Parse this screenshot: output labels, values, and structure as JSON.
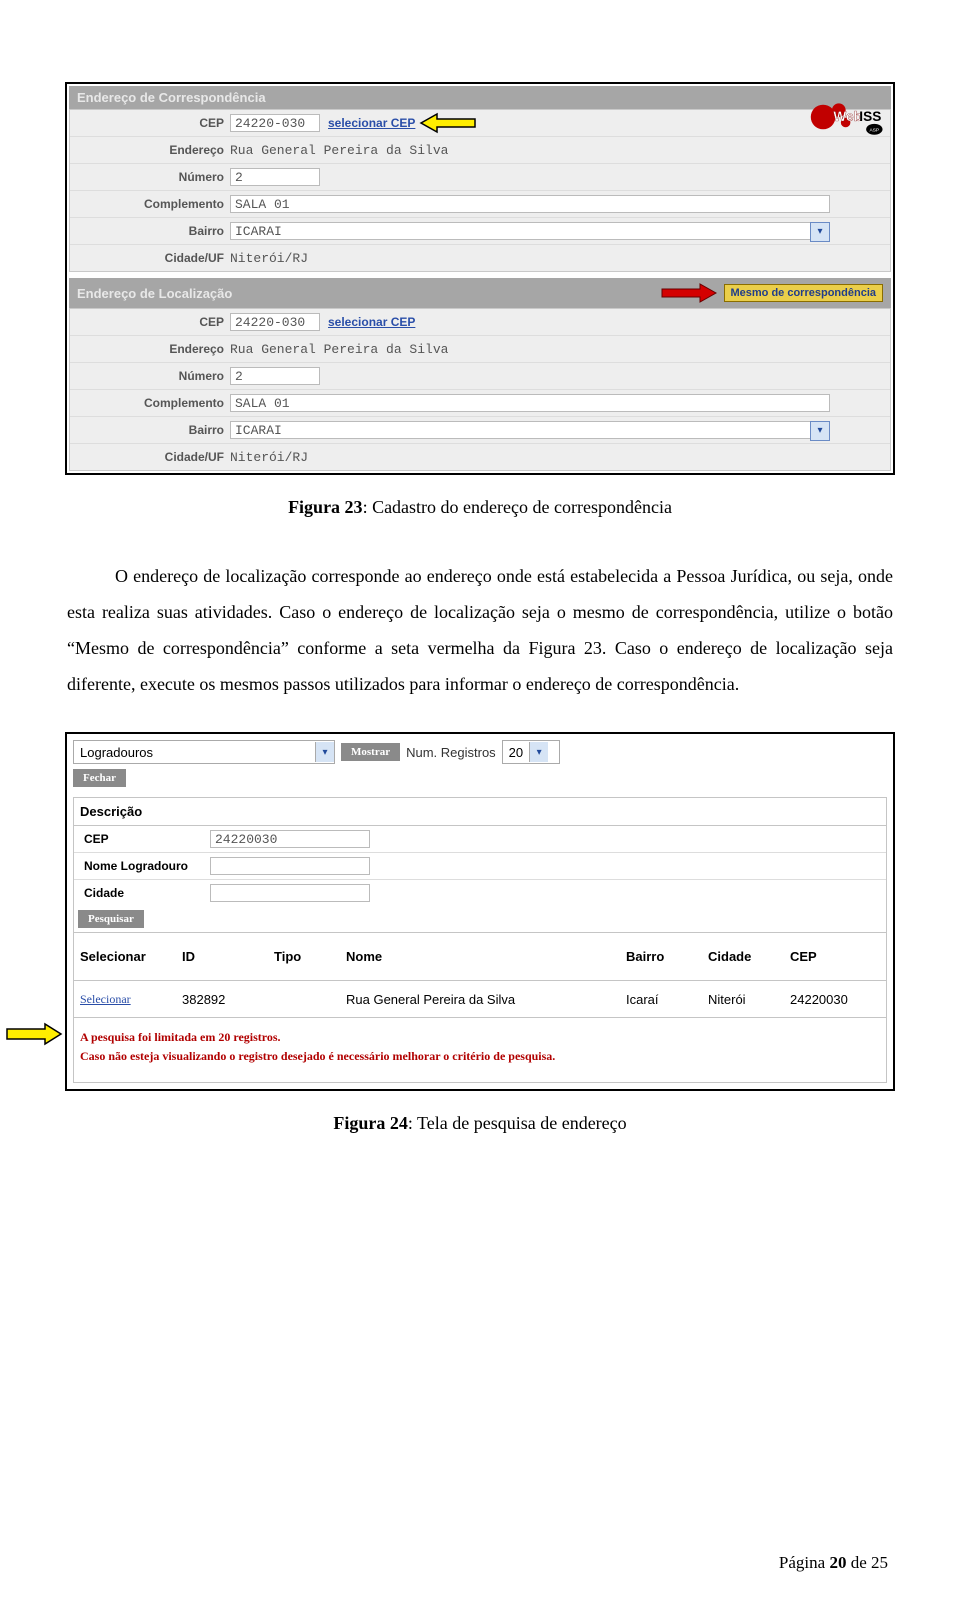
{
  "logo_text": "WebISS",
  "section1": {
    "title": "Endereço de Correspondência",
    "cep_label": "CEP",
    "cep_value": "24220-030",
    "cep_link": "selecionar CEP",
    "endereco_label": "Endereço",
    "endereco_value": "Rua General Pereira da Silva",
    "numero_label": "Número",
    "numero_value": "2",
    "complemento_label": "Complemento",
    "complemento_value": "SALA 01",
    "bairro_label": "Bairro",
    "bairro_value": "ICARAI",
    "cidade_label": "Cidade/UF",
    "cidade_value": "Niterói/RJ"
  },
  "section2": {
    "title": "Endereço de Localização",
    "mesmo_btn": "Mesmo de correspondência",
    "cep_label": "CEP",
    "cep_value": "24220-030",
    "cep_link": "selecionar CEP",
    "endereco_label": "Endereço",
    "endereco_value": "Rua General Pereira da Silva",
    "numero_label": "Número",
    "numero_value": "2",
    "complemento_label": "Complemento",
    "complemento_value": "SALA 01",
    "bairro_label": "Bairro",
    "bairro_value": "ICARAI",
    "cidade_label": "Cidade/UF",
    "cidade_value": "Niterói/RJ"
  },
  "caption1_b": "Figura 23",
  "caption1_r": ": Cadastro do endereço de correspondência",
  "paragraph": "O endereço de localização corresponde ao endereço onde está estabelecida a Pessoa Jurídica, ou seja, onde esta realiza suas atividades. Caso o endereço de localização seja o mesmo de correspondência, utilize o botão “Mesmo de correspondência” conforme a seta vermelha da Figura 23. Caso o endereço de localização seja diferente, execute os mesmos passos utilizados para informar o endereço de correspondência.",
  "figure2": {
    "combo_value": "Logradouros",
    "btn_mostrar": "Mostrar",
    "reg_label": "Num. Registros",
    "reg_value": "20",
    "btn_fechar": "Fechar",
    "desc_heading": "Descrição",
    "cep_label": "CEP",
    "cep_value": "24220030",
    "nome_label": "Nome Logradouro",
    "nome_value": "",
    "cidade_label": "Cidade",
    "cidade_value": "",
    "btn_pesquisar": "Pesquisar",
    "columns": {
      "sel": "Selecionar",
      "id": "ID",
      "tipo": "Tipo",
      "nome": "Nome",
      "bairro": "Bairro",
      "cidade": "Cidade",
      "cep": "CEP"
    },
    "row": {
      "sel": "Selecionar",
      "id": "382892",
      "tipo": "",
      "nome": "Rua General Pereira da Silva",
      "bairro": "Icaraí",
      "cidade": "Niterói",
      "cep": "24220030"
    },
    "warn1": "A pesquisa foi limitada em 20 registros.",
    "warn2": "Caso não esteja visualizando o registro desejado é necessário melhorar o critério de pesquisa."
  },
  "caption2_b": "Figura 24",
  "caption2_r": ": Tela de pesquisa de endereço",
  "footer_pre": "Página ",
  "footer_num": "20",
  "footer_post": " de 25"
}
